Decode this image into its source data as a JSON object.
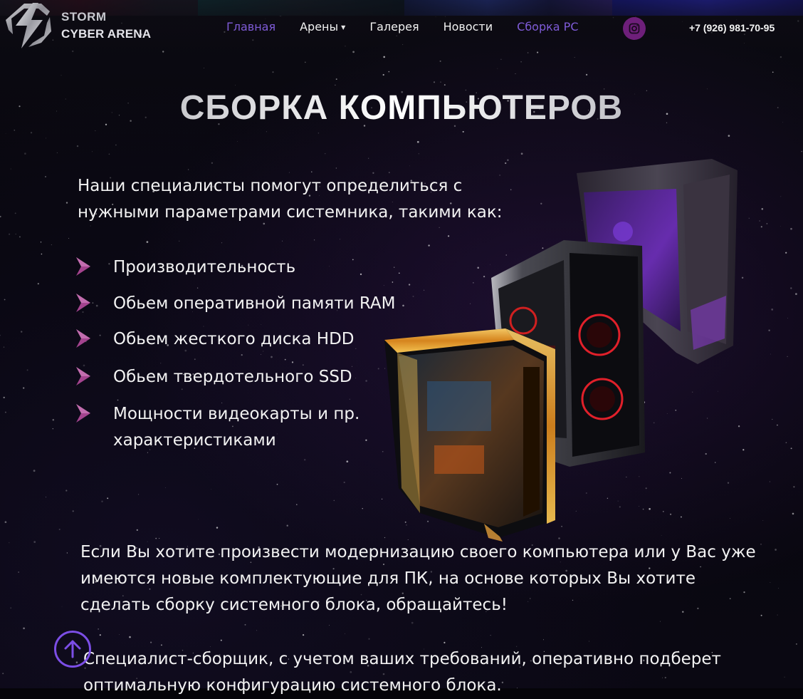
{
  "brand": {
    "line1": "STORM",
    "line2": "CYBER ARENA"
  },
  "nav": {
    "items": [
      {
        "label": "Главная",
        "active": true
      },
      {
        "label": "Арены",
        "has_dropdown": true
      },
      {
        "label": "Галерея"
      },
      {
        "label": "Новости"
      },
      {
        "label": "Сборка PC",
        "accent": true
      }
    ]
  },
  "social": {
    "icon": "instagram-icon"
  },
  "phone": "+7 (926) 981-70-95",
  "page": {
    "title": "СБОРКА КОМПЬЮТЕРОВ",
    "intro": "Наши специалисты помогут определиться с нужными параметрами системника, такими как:",
    "features": [
      "Производительность",
      "Обьем оперативной памяти RAM",
      "Обьем жесткого диска HDD",
      "Обьем твердотельного SSD",
      "Мощности видеокарты и пр. характеристиками"
    ],
    "paragraph1": "Если Вы хотите произвести модернизацию своего компьютера или у Вас уже имеются новые комплектующие для ПК, на основе которых Вы хотите сделать сборку системного блока, обращайтесь!",
    "paragraph2": "Специалист-сборщик, с учетом ваших требований, оперативно подберет оптимальную конфигурацию системного блока."
  },
  "colors": {
    "accent": "#7f5bd8",
    "chevron": "#b54a9c",
    "instagram_bg": "#6e1f7a",
    "scroll_button": "#7c4ee6"
  },
  "icons": {
    "bullet": "chevron-right-icon",
    "scroll_top": "arrow-up-icon"
  }
}
